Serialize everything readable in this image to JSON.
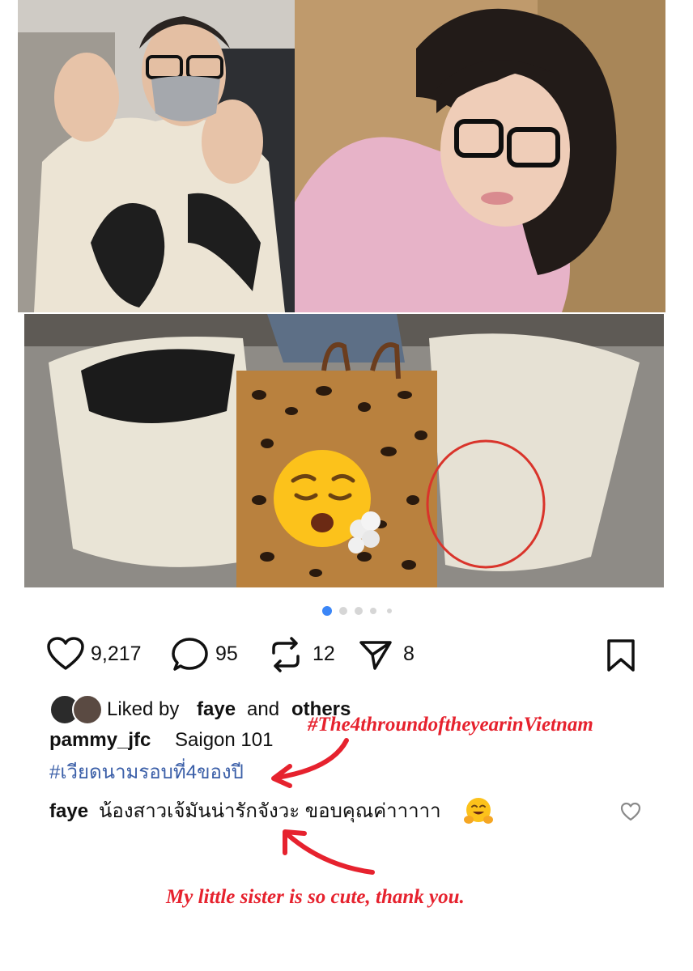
{
  "media": {
    "images": [
      {
        "name": "airport photo"
      },
      {
        "name": "selfie photo"
      },
      {
        "name": "shopping bags photo"
      }
    ],
    "pagination": {
      "total": 5,
      "active": 1
    }
  },
  "actions": {
    "likes": "9,217",
    "comments": "95",
    "reposts": "12",
    "shares": "8"
  },
  "likes_line": {
    "prefix": "Liked by",
    "user": "faye",
    "middle": "and",
    "others": "others"
  },
  "caption": {
    "username": "pammy_jfc",
    "text": "Saigon 101",
    "hashtag": "#เวียดนามรอบที่4ของปี"
  },
  "comment": {
    "username": "faye",
    "text": "น้องสาวเจ้มันน่ารักจังวะ ขอบคุณค่าาาาา",
    "emoji": "🤗"
  },
  "annotations": {
    "hashtag_translation": "#The4throundoftheyearinVietnam",
    "comment_translation": "My little sister is so cute, thank you."
  },
  "colors": {
    "hashtag": "#3b5fa8",
    "annotation": "#e6222e",
    "text": "#111111"
  },
  "icons": [
    "heart-icon",
    "comment-icon",
    "repost-icon",
    "share-icon",
    "bookmark-icon",
    "heart-outline-icon",
    "hugging-face-emoji",
    "exhale-face-emoji"
  ]
}
